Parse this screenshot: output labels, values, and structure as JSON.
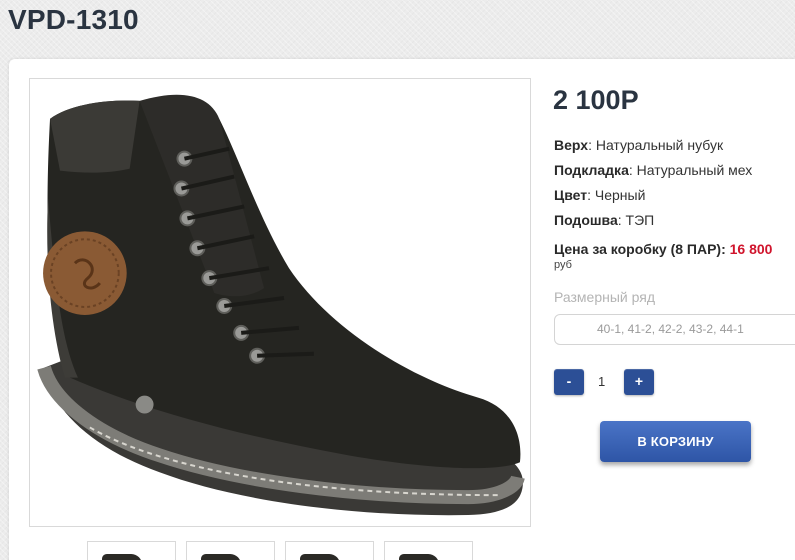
{
  "product": {
    "title": "VPD-1310",
    "price": "2 100Р"
  },
  "specs": [
    {
      "label": "Верх",
      "value": ": Натуральный нубук"
    },
    {
      "label": "Подкладка",
      "value": ": Натуральный мех"
    },
    {
      "label": "Цвет",
      "value": ": Черный"
    },
    {
      "label": "Подошва",
      "value": ": ТЭП"
    }
  ],
  "box_price": {
    "label": "Цена за коробку (8 ПАР): ",
    "value": "16 800",
    "currency": "руб"
  },
  "sizes": {
    "label": "Размерный ряд",
    "selected": "40-1, 41-2, 42-2, 43-2, 44-1"
  },
  "quantity": {
    "minus": "-",
    "value": "1",
    "plus": "+"
  },
  "cart_button": "В КОРЗИНУ",
  "colors": {
    "accent_blue": "#2c4f96",
    "price_red": "#d0142c",
    "title": "#2a3441"
  },
  "icons": {
    "main": "boot-image",
    "thumbnails": [
      "boot-thumbnail",
      "boot-thumbnail",
      "boot-thumbnail",
      "boot-thumbnail"
    ]
  }
}
